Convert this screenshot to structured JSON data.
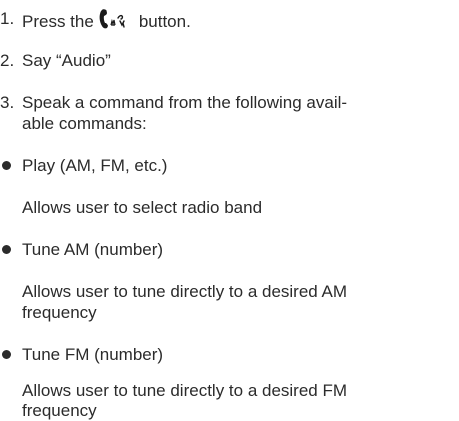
{
  "steps": [
    {
      "number": "1.",
      "text_before": "Press the",
      "icon": "phone-voice-icon",
      "text_after": "button."
    },
    {
      "number": "2.",
      "text": "Say “Audio”"
    },
    {
      "number": "3.",
      "line1": "Speak a command from the following avail-",
      "line2": "able commands:"
    }
  ],
  "commands": [
    {
      "name": "Play (AM, FM, etc.)",
      "desc_line1": "Allows user to select radio band",
      "desc_line2": ""
    },
    {
      "name": "Tune AM (number)",
      "desc_line1": "Allows user to tune directly to a desired AM",
      "desc_line2": "frequency"
    },
    {
      "name": "Tune FM (number)",
      "desc_line1": "Allows user to tune directly to a desired FM",
      "desc_line2": "frequency"
    }
  ]
}
